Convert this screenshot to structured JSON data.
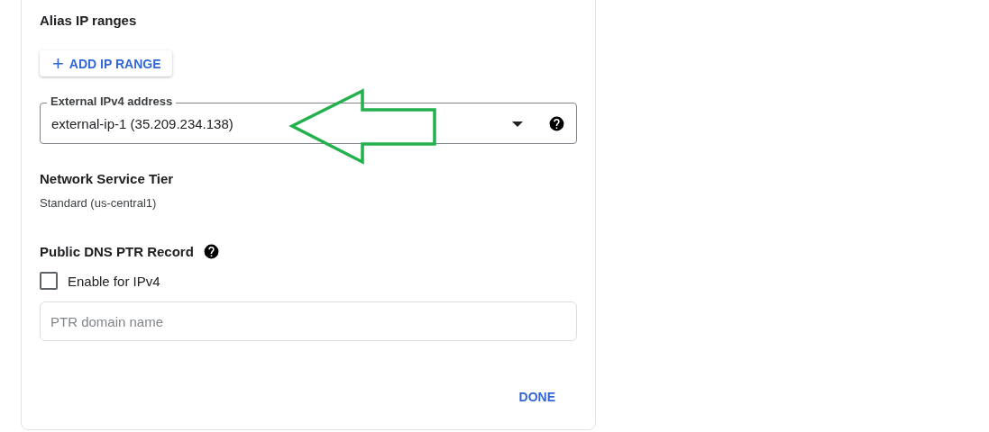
{
  "alias_ip_ranges": {
    "title": "Alias IP ranges",
    "add_button": {
      "icon": "+",
      "label": "ADD IP RANGE"
    }
  },
  "external_ipv4": {
    "label": "External IPv4 address",
    "value": "external-ip-1 (35.209.234.138)"
  },
  "network_service_tier": {
    "title": "Network Service Tier",
    "value": "Standard (us-central1)"
  },
  "public_dns_ptr": {
    "title": "Public DNS PTR Record",
    "checkbox": {
      "label": "Enable for IPv4",
      "checked": false
    },
    "field": {
      "placeholder": "PTR domain name"
    }
  },
  "done_button": "DONE"
}
